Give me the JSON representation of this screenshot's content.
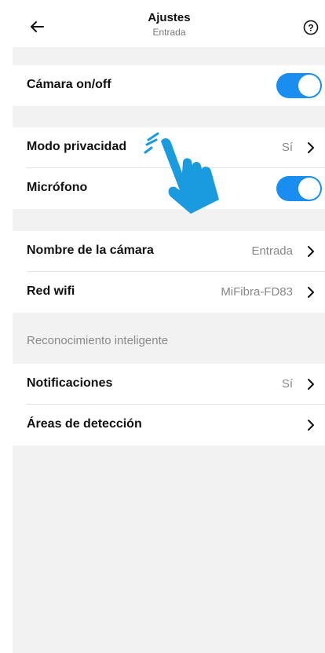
{
  "header": {
    "title": "Ajustes",
    "subtitle": "Entrada",
    "back_icon": "arrow-left-icon",
    "help_icon": "question-circle-icon"
  },
  "camera": {
    "label": "Cámara on/off",
    "toggle_on": true
  },
  "privacy": {
    "mode_label": "Modo privacidad",
    "mode_value": "Sí",
    "mic_label": "Micrófono",
    "mic_on": true
  },
  "device": {
    "name_label": "Nombre de la cámara",
    "name_value": "Entrada",
    "wifi_label": "Red wifi",
    "wifi_value": "MiFibra-FD83"
  },
  "smart": {
    "section_title": "Reconocimiento inteligente",
    "notifications_label": "Notificaciones",
    "notifications_value": "Sí",
    "areas_label": "Áreas de detección"
  },
  "colors": {
    "accent": "#1a8ef0",
    "background": "#f2f2f2",
    "hand": "#1a9be0"
  }
}
